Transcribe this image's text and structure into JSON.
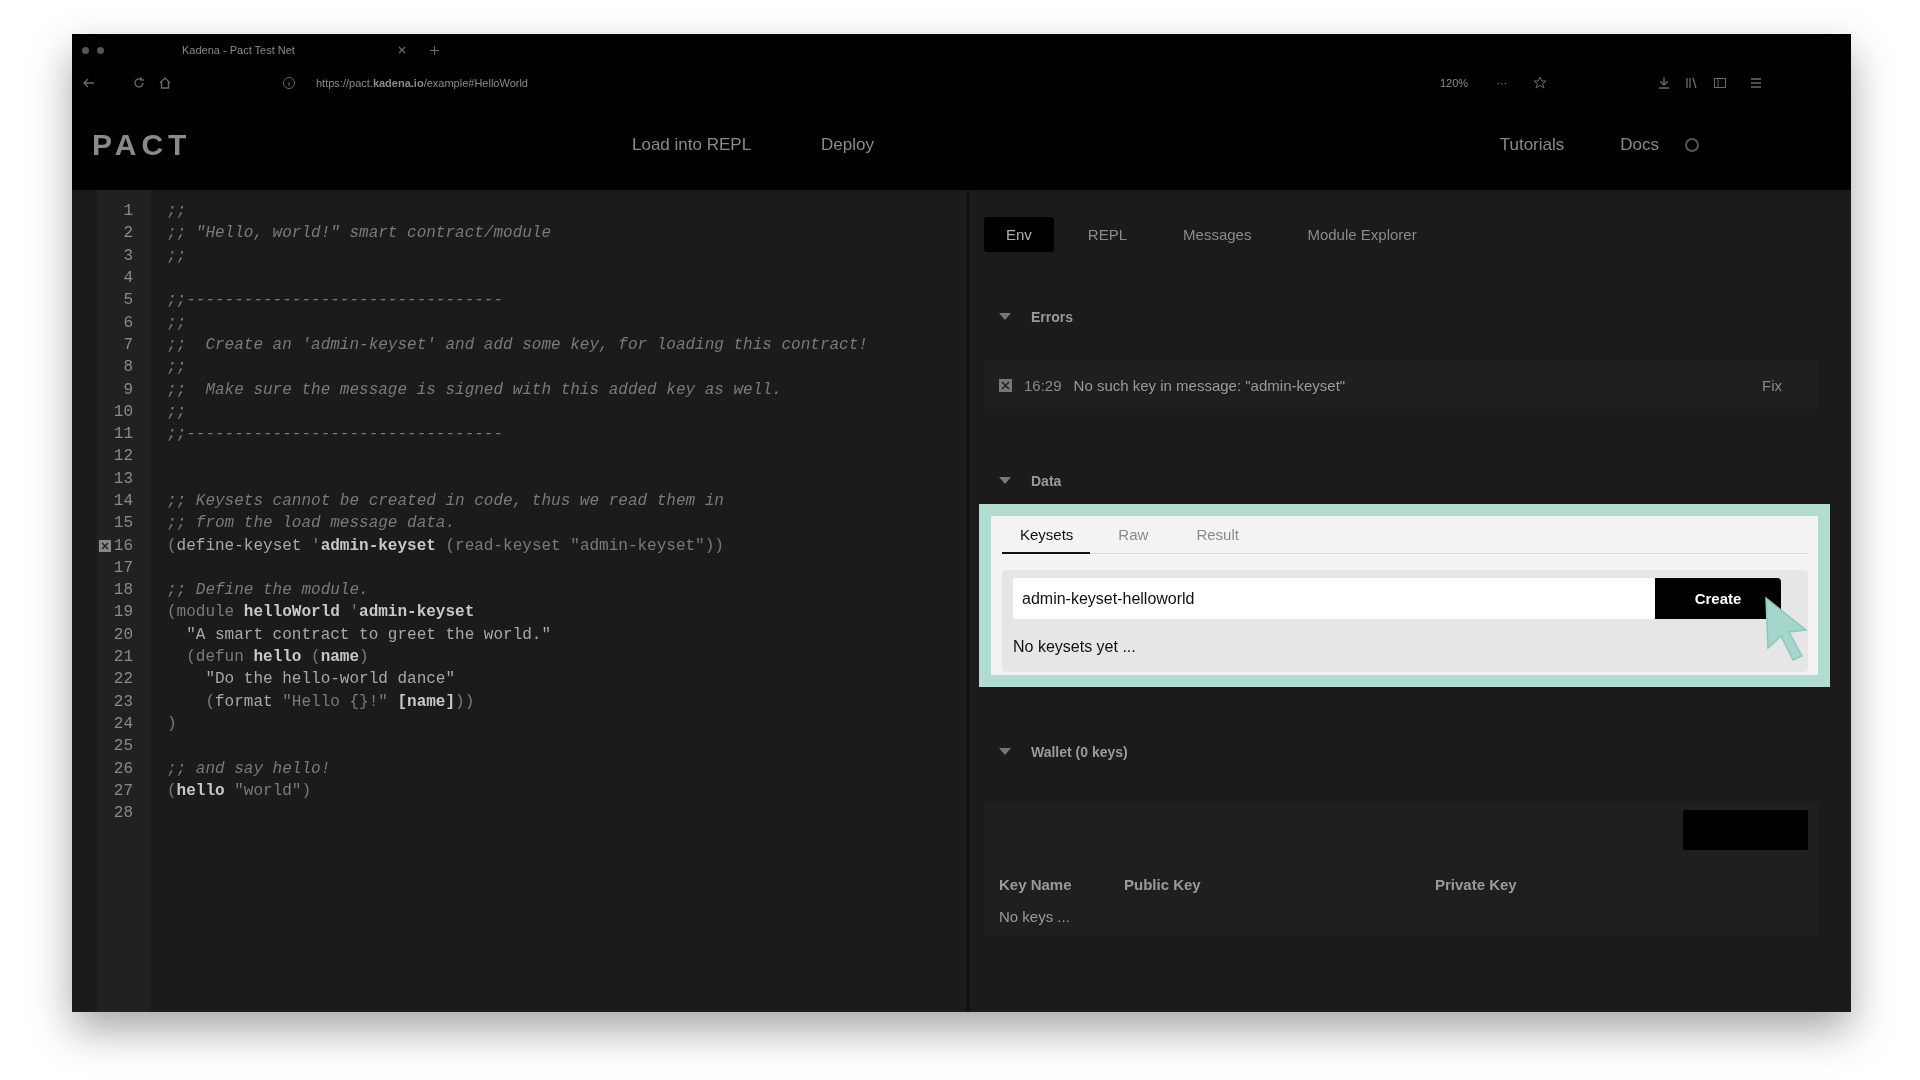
{
  "browser": {
    "tab_title": "Kadena - Pact Test Net",
    "url": "https://pact.**kadena.io**/example#HelloWorld",
    "zoom": "120%",
    "more": "···"
  },
  "header": {
    "logo": "PACT",
    "nav": [
      "Load into REPL",
      "Deploy"
    ],
    "links": [
      "Tutorials",
      "Docs"
    ]
  },
  "editor": {
    "lines": [
      {
        "number": "1",
        "error": false,
        "segments": [
          {
            "kind": "comment",
            "text": ";;"
          }
        ]
      },
      {
        "number": "2",
        "error": false,
        "segments": [
          {
            "kind": "comment",
            "text": ";; \"Hello, world!\" smart contract/module"
          }
        ]
      },
      {
        "number": "3",
        "error": false,
        "segments": [
          {
            "kind": "comment",
            "text": ";;"
          }
        ]
      },
      {
        "number": "4",
        "error": false
      },
      {
        "number": "5",
        "error": false,
        "segments": [
          {
            "kind": "comment",
            "text": ";;---------------------------------"
          }
        ]
      },
      {
        "number": "6",
        "error": false,
        "segments": [
          {
            "kind": "comment",
            "text": ";;"
          }
        ]
      },
      {
        "number": "7",
        "error": false,
        "segments": [
          {
            "kind": "comment",
            "text": ";;  Create an 'admin-keyset' and add some key, for loading this contract!"
          }
        ]
      },
      {
        "number": "8",
        "error": false,
        "segments": [
          {
            "kind": "comment",
            "text": ";;"
          }
        ]
      },
      {
        "number": "9",
        "error": false,
        "segments": [
          {
            "kind": "comment",
            "text": ";;  Make sure the message is signed with this added key as well."
          }
        ]
      },
      {
        "number": "10",
        "error": false,
        "segments": [
          {
            "kind": "comment",
            "text": ";;"
          }
        ]
      },
      {
        "number": "11",
        "error": false,
        "segments": [
          {
            "kind": "comment",
            "text": ";;---------------------------------"
          }
        ]
      },
      {
        "number": "12",
        "error": false
      },
      {
        "number": "13",
        "error": false
      },
      {
        "number": "14",
        "error": false,
        "segments": [
          {
            "kind": "comment",
            "text": ";; Keysets cannot be created in code, thus we read them in"
          }
        ]
      },
      {
        "number": "15",
        "error": false,
        "segments": [
          {
            "kind": "comment",
            "text": ";; from the load message data."
          }
        ]
      },
      {
        "number": "16",
        "error": true,
        "segments": [
          {
            "kind": "faint",
            "text": "("
          },
          {
            "kind": "plain",
            "text": "define-keyset "
          },
          {
            "kind": "faint",
            "text": "'"
          },
          {
            "kind": "strong",
            "text": "admin-keyset"
          },
          {
            "kind": "faint",
            "text": " (read-keyset \"admin-keyset\"))"
          }
        ]
      },
      {
        "number": "17",
        "error": false
      },
      {
        "number": "18",
        "error": false,
        "segments": [
          {
            "kind": "comment",
            "text": ";; Define the module."
          }
        ]
      },
      {
        "number": "19",
        "error": false,
        "segments": [
          {
            "kind": "faint",
            "text": "(module "
          },
          {
            "kind": "strong",
            "text": "helloWorld"
          },
          {
            "kind": "faint",
            "text": " '"
          },
          {
            "kind": "strong",
            "text": "admin-keyset"
          }
        ]
      },
      {
        "number": "20",
        "error": false,
        "segments": [
          {
            "kind": "plain",
            "text": "  \"A smart contract to greet the world.\""
          }
        ]
      },
      {
        "number": "21",
        "error": false,
        "segments": [
          {
            "kind": "faint",
            "text": "  (defun "
          },
          {
            "kind": "strong",
            "text": "hello"
          },
          {
            "kind": "faint",
            "text": " ("
          },
          {
            "kind": "strong",
            "text": "name"
          },
          {
            "kind": "faint",
            "text": ")"
          }
        ]
      },
      {
        "number": "22",
        "error": false,
        "segments": [
          {
            "kind": "plain",
            "text": "    \"Do the hello-world dance\""
          }
        ]
      },
      {
        "number": "23",
        "error": false,
        "segments": [
          {
            "kind": "faint",
            "text": "    ("
          },
          {
            "kind": "plain",
            "text": "format "
          },
          {
            "kind": "faint",
            "text": "\"Hello {}!\" "
          },
          {
            "kind": "strong",
            "text": "[name]"
          },
          {
            "kind": "faint",
            "text": "))"
          }
        ]
      },
      {
        "number": "24",
        "error": false,
        "segments": [
          {
            "kind": "faint",
            "text": ")"
          }
        ]
      },
      {
        "number": "25",
        "error": false
      },
      {
        "number": "26",
        "error": false,
        "segments": [
          {
            "kind": "comment",
            "text": ";; and say hello!"
          }
        ]
      },
      {
        "number": "27",
        "error": false,
        "segments": [
          {
            "kind": "faint",
            "text": "("
          },
          {
            "kind": "strong",
            "text": "hello"
          },
          {
            "kind": "faint",
            "text": " \"world\")"
          }
        ]
      },
      {
        "number": "28",
        "error": false
      }
    ]
  },
  "panel": {
    "tabs": [
      {
        "label": "Env",
        "selected": true
      },
      {
        "label": "REPL",
        "selected": false
      },
      {
        "label": "Messages",
        "selected": false
      },
      {
        "label": "Module Explorer",
        "selected": false
      }
    ],
    "errors": {
      "title": "Errors",
      "expanded": true,
      "items": [
        {
          "time": "16:29",
          "message": "No such key in message: \"admin-keyset\"",
          "action": "Fix"
        }
      ]
    },
    "data": {
      "title": "Data",
      "expanded": true,
      "tabs": [
        {
          "label": "Keysets",
          "selected": true
        },
        {
          "label": "Raw",
          "selected": false
        },
        {
          "label": "Result",
          "selected": false
        }
      ],
      "keyset_name": "admin-keyset-helloworld",
      "create_button": "Create",
      "empty_text": "No keysets yet ..."
    },
    "wallet": {
      "title": "Wallet (0 keys)",
      "expanded": true,
      "columns": [
        "Key Name",
        "Public Key",
        "Private Key"
      ],
      "empty_text": "No keys ..."
    }
  }
}
